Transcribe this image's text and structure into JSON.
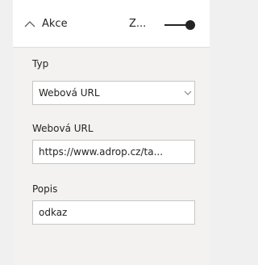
{
  "section": {
    "title": "Akce",
    "toggle_label": "Z...",
    "toggle_on": true
  },
  "fields": {
    "type": {
      "label": "Typ",
      "value": "Webová URL"
    },
    "url": {
      "label": "Webová URL",
      "value": "https://www.adrop.cz/ta..."
    },
    "description": {
      "label": "Popis",
      "value": "odkaz"
    }
  },
  "icons": {
    "header_chevron": "chevron-up-icon",
    "select_chevron": "chevron-down-icon"
  }
}
